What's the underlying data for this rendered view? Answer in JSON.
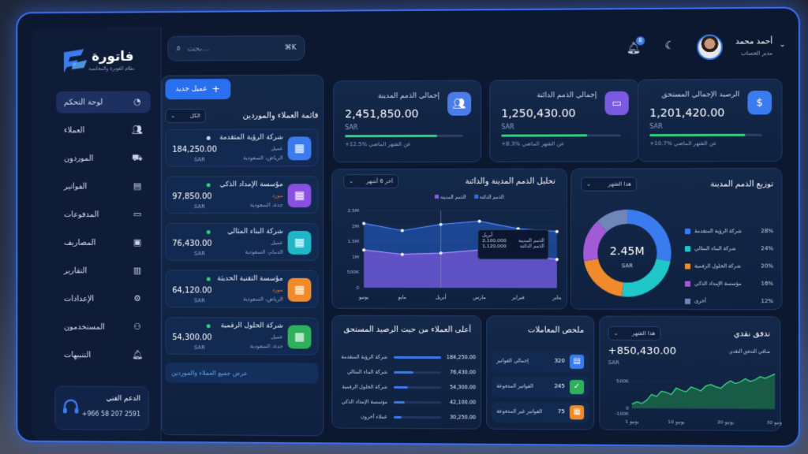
{
  "app": {
    "logo_text": "فاتورة",
    "logo_sub": "نظام الفوترة والمحاسبة"
  },
  "search": {
    "placeholder": "بحث...",
    "shortcut": "⌘K"
  },
  "user": {
    "name": "أحمد محمد",
    "role": "مدير الحساب",
    "notifications": "8"
  },
  "nav": [
    {
      "label": "لوحة التحكم",
      "icon": "dashboard-icon",
      "active": true
    },
    {
      "label": "العملاء",
      "icon": "users-icon"
    },
    {
      "label": "الموردون",
      "icon": "truck-icon"
    },
    {
      "label": "الفواتير",
      "icon": "invoice-icon"
    },
    {
      "label": "المدفوعات",
      "icon": "payments-icon"
    },
    {
      "label": "المصاريف",
      "icon": "wallet-icon"
    },
    {
      "label": "التقارير",
      "icon": "reports-icon"
    },
    {
      "label": "الإعدادات",
      "icon": "gear-icon"
    },
    {
      "label": "المستخدمون",
      "icon": "user-group-icon"
    },
    {
      "label": "التنبيهات",
      "icon": "bell-icon"
    }
  ],
  "support": {
    "title": "الدعم الفني",
    "phone": "+966 58 207 2591"
  },
  "clients_panel": {
    "add_button": "عميل جديد",
    "title": "قائمة العملاء والموردين",
    "filter": "الكل",
    "view_all": "عرض جميع العملاء والموردين",
    "items": [
      {
        "name": "شركة الرؤية المتقدمة",
        "type": "عميل",
        "city": "الرياض، السعودية",
        "amount": "184,250.00",
        "currency": "SAR",
        "color": "#3a7bf0"
      },
      {
        "name": "مؤسسة الإمداد الذكي",
        "type": "مورد",
        "city": "جدة، السعودية",
        "amount": "97,850.00",
        "currency": "SAR",
        "color": "#8a4fe0"
      },
      {
        "name": "شركة البناء المثالي",
        "type": "عميل",
        "city": "الدمام، السعودية",
        "amount": "76,430.00",
        "currency": "SAR",
        "color": "#1fb7c8"
      },
      {
        "name": "مؤسسة التقنية الحديثة",
        "type": "مورد",
        "city": "الرياض، السعودية",
        "amount": "64,120.00",
        "currency": "SAR",
        "color": "#f08a2a"
      },
      {
        "name": "شركة الحلول الرقمية",
        "type": "عميل",
        "city": "جدة، السعودية",
        "amount": "54,300.00",
        "currency": "SAR",
        "color": "#2fb05a"
      }
    ]
  },
  "kpis": [
    {
      "title": "إجمالي الذمم المدينة",
      "value": "2,451,850.00",
      "currency": "SAR",
      "change": "+12.5% عن الشهر الماضي",
      "color": "#4a7de8",
      "icon": "users-icon",
      "fill": 0.78
    },
    {
      "title": "إجمالي الذمم الدائنة",
      "value": "1,250,430.00",
      "currency": "SAR",
      "change": "+8.3% عن الشهر الماضي",
      "color": "#7a5ae0",
      "icon": "card-icon",
      "fill": 0.72
    },
    {
      "title": "الرصيد الإجمالي المستحق",
      "value": "1,201,420.00",
      "currency": "SAR",
      "change": "+10.7% عن الشهر الماضي",
      "color": "#3a7bf0",
      "icon": "dollar-icon",
      "fill": 0.85
    }
  ],
  "analysis": {
    "title": "تحليل الذمم المدينة والدائنة",
    "period": "آخر 6 أشهر",
    "legend_payable": "الذمم الدائنة",
    "legend_receivable": "الذمم المدينة",
    "tooltip": {
      "month": "أبريل",
      "receivable_label": "الذمم المدينة",
      "receivable_value": "2,100,000",
      "payable_label": "الذمم الدائنة",
      "payable_value": "1,120,000"
    }
  },
  "distribution": {
    "title": "توزيع الذمم المدينة",
    "period": "هذا الشهر",
    "center_value": "2.45M",
    "center_unit": "SAR",
    "items": [
      {
        "name": "شركة الرؤية المتقدمة",
        "pct": "28%",
        "value": 28,
        "color": "#3a7bf0"
      },
      {
        "name": "شركة البناء المثالي",
        "pct": "24%",
        "value": 24,
        "color": "#1fc7c8"
      },
      {
        "name": "شركة الحلول الرقمية",
        "pct": "20%",
        "value": 20,
        "color": "#f08a2a"
      },
      {
        "name": "مؤسسة الإمداد الذكي",
        "pct": "16%",
        "value": 16,
        "color": "#a35ad8"
      },
      {
        "name": "أخرى",
        "pct": "12%",
        "value": 12,
        "color": "#6f86b8"
      }
    ]
  },
  "top_clients": {
    "title": "أعلى العملاء من حيث الرصيد المستحق",
    "items": [
      {
        "name": "شركة الرؤية المتقدمة",
        "value": "184,250.00",
        "fill": 1.0
      },
      {
        "name": "شركة البناء المثالي",
        "value": "76,430.00",
        "fill": 0.42
      },
      {
        "name": "شركة الحلول الرقمية",
        "value": "54,300.00",
        "fill": 0.3
      },
      {
        "name": "مؤسسة الإمداد الذكي",
        "value": "42,100.00",
        "fill": 0.23
      },
      {
        "name": "عملاء آخرون",
        "value": "30,250.00",
        "fill": 0.17
      }
    ]
  },
  "summary": {
    "title": "ملخص المعاملات",
    "items": [
      {
        "label": "إجمالي الفواتير",
        "value": "320",
        "color": "#3a7bf0",
        "icon": "document-icon"
      },
      {
        "label": "الفواتير المدفوعة",
        "value": "245",
        "color": "#2fb05a",
        "icon": "check-icon"
      },
      {
        "label": "الفواتير غير المدفوعة",
        "value": "75",
        "color": "#f08a2a",
        "icon": "clipboard-icon"
      }
    ]
  },
  "cashflow": {
    "title": "تدفق نقدي",
    "period": "هذا الشهر",
    "value": "+850,430.00",
    "currency": "SAR",
    "subtitle": "صافي التدفق النقدي"
  },
  "chart_data": [
    {
      "type": "area",
      "title": "تحليل الذمم المدينة والدائنة",
      "categories": [
        "يناير",
        "فبراير",
        "مارس",
        "أبريل",
        "مايو",
        "يونيو"
      ],
      "ytick_labels": [
        "0",
        "500K",
        "1M",
        "1.5M",
        "2M",
        "2.5M"
      ],
      "ylim": [
        0,
        2500000
      ],
      "series": [
        {
          "name": "الذمم الدائنة",
          "values": [
            1820000,
            1910000,
            2150000,
            2050000,
            1850000,
            2080000
          ],
          "color": "#2a6ff0"
        },
        {
          "name": "الذمم المدينة",
          "values": [
            920000,
            1060000,
            1220000,
            1120000,
            1080000,
            1220000
          ],
          "color": "#8a5ae8"
        }
      ]
    },
    {
      "type": "pie",
      "title": "توزيع الذمم المدينة",
      "categories": [
        "شركة الرؤية المتقدمة",
        "شركة البناء المثالي",
        "شركة الحلول الرقمية",
        "مؤسسة الإمداد الذكي",
        "أخرى"
      ],
      "values": [
        28,
        24,
        20,
        16,
        12
      ]
    },
    {
      "type": "area",
      "title": "تدفق نقدي",
      "x": [
        1,
        2,
        3,
        4,
        5,
        6,
        7,
        8,
        9,
        10,
        11,
        12,
        13,
        14,
        15,
        16,
        17,
        18,
        19,
        20,
        21,
        22,
        23,
        24,
        25,
        26,
        27,
        28,
        29,
        30
      ],
      "xtick_labels": [
        "1 يونيو",
        "10 يونيو",
        "20 يونيو",
        "30 يونيو"
      ],
      "ytick_labels": [
        "-100K",
        "0",
        "500K"
      ],
      "ylim": [
        -100000,
        700000
      ],
      "values": [
        80000,
        120000,
        90000,
        150000,
        260000,
        220000,
        320000,
        300000,
        260000,
        380000,
        340000,
        310000,
        400000,
        370000,
        330000,
        420000,
        450000,
        410000,
        380000,
        460000,
        520000,
        470000,
        500000,
        560000,
        510000,
        540000,
        600000,
        570000,
        610000,
        650000
      ]
    }
  ]
}
